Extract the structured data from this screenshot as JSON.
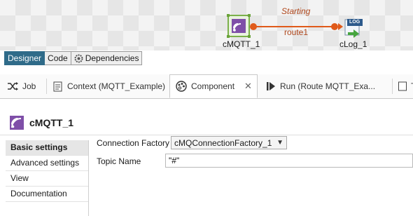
{
  "canvas": {
    "connection_status": "Starting",
    "connection_label": "route1",
    "source_node": "cMQTT_1",
    "target_node": "cLog_1",
    "log_badge": "LOG"
  },
  "designer_tabs": [
    "Designer",
    "Code",
    "Dependencies"
  ],
  "view_tabs": {
    "job": "Job",
    "context": "Context (MQTT_Example)",
    "component": "Component",
    "run": "Run (Route MQTT_Exa...",
    "more": "T"
  },
  "component": {
    "title": "cMQTT_1"
  },
  "settings_nav": [
    "Basic settings",
    "Advanced settings",
    "View",
    "Documentation"
  ],
  "form": {
    "factory_label": "Connection Factory",
    "factory_value": "cMQConnectionFactory_1",
    "topic_label": "Topic Name",
    "topic_value": "\"#\""
  },
  "colors": {
    "accent": "#2f6b89",
    "connector": "#e05a1a",
    "component_purple": "#8a5bb0"
  }
}
